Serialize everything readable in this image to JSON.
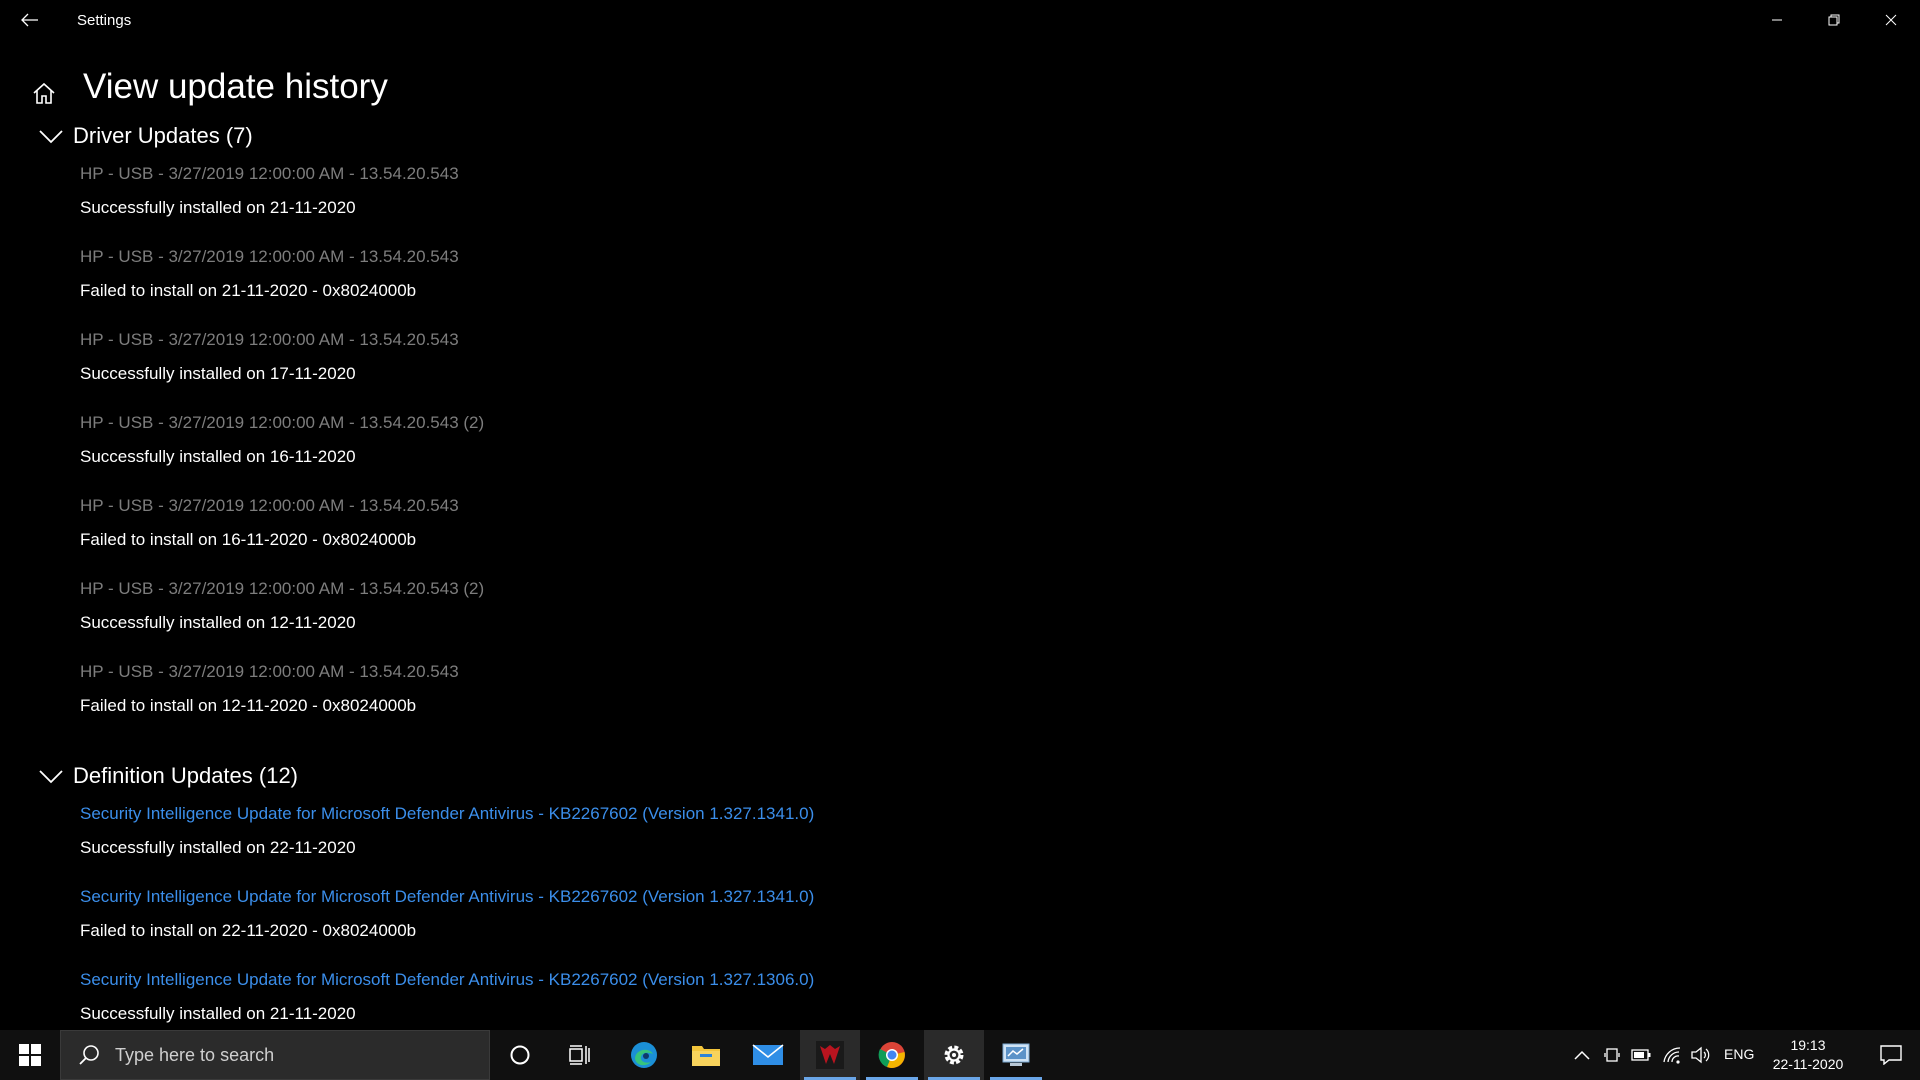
{
  "window": {
    "title": "Settings"
  },
  "page": {
    "title": "View update history"
  },
  "sections": [
    {
      "title": "Driver Updates (7)",
      "items": [
        {
          "name": "HP - USB - 3/27/2019 12:00:00 AM - 13.54.20.543",
          "status": "Successfully installed on 21-11-2020"
        },
        {
          "name": "HP - USB - 3/27/2019 12:00:00 AM - 13.54.20.543",
          "status": "Failed to install on 21-11-2020 - 0x8024000b"
        },
        {
          "name": "HP - USB - 3/27/2019 12:00:00 AM - 13.54.20.543",
          "status": "Successfully installed on 17-11-2020"
        },
        {
          "name": "HP - USB - 3/27/2019 12:00:00 AM - 13.54.20.543 (2)",
          "status": "Successfully installed on 16-11-2020"
        },
        {
          "name": "HP - USB - 3/27/2019 12:00:00 AM - 13.54.20.543",
          "status": "Failed to install on 16-11-2020 - 0x8024000b"
        },
        {
          "name": "HP - USB - 3/27/2019 12:00:00 AM - 13.54.20.543 (2)",
          "status": "Successfully installed on 12-11-2020"
        },
        {
          "name": "HP - USB - 3/27/2019 12:00:00 AM - 13.54.20.543",
          "status": "Failed to install on 12-11-2020 - 0x8024000b"
        }
      ]
    },
    {
      "title": "Definition Updates (12)",
      "items": [
        {
          "name": "Security Intelligence Update for Microsoft Defender Antivirus - KB2267602 (Version 1.327.1341.0)",
          "status": "Successfully installed on 22-11-2020"
        },
        {
          "name": "Security Intelligence Update for Microsoft Defender Antivirus - KB2267602 (Version 1.327.1341.0)",
          "status": "Failed to install on 22-11-2020 - 0x8024000b"
        },
        {
          "name": "Security Intelligence Update for Microsoft Defender Antivirus - KB2267602 (Version 1.327.1306.0)",
          "status": "Successfully installed on 21-11-2020"
        }
      ]
    }
  ],
  "taskbar": {
    "search_placeholder": "Type here to search",
    "language": "ENG",
    "time": "19:13",
    "date": "22-11-2020",
    "apps": [
      "cortana-icon",
      "task-view-icon",
      "edge-icon",
      "file-explorer-icon",
      "mail-icon",
      "predator-sense-icon",
      "chrome-icon",
      "settings-icon",
      "control-panel-icon"
    ],
    "tray_icons": [
      "chevron-up-icon",
      "device-icon",
      "battery-icon",
      "wifi-icon",
      "volume-icon"
    ]
  },
  "colors": {
    "background": "#000000",
    "link": "#3b8eea",
    "muted_text": "#7d7d7d",
    "taskbar": "#101010"
  }
}
